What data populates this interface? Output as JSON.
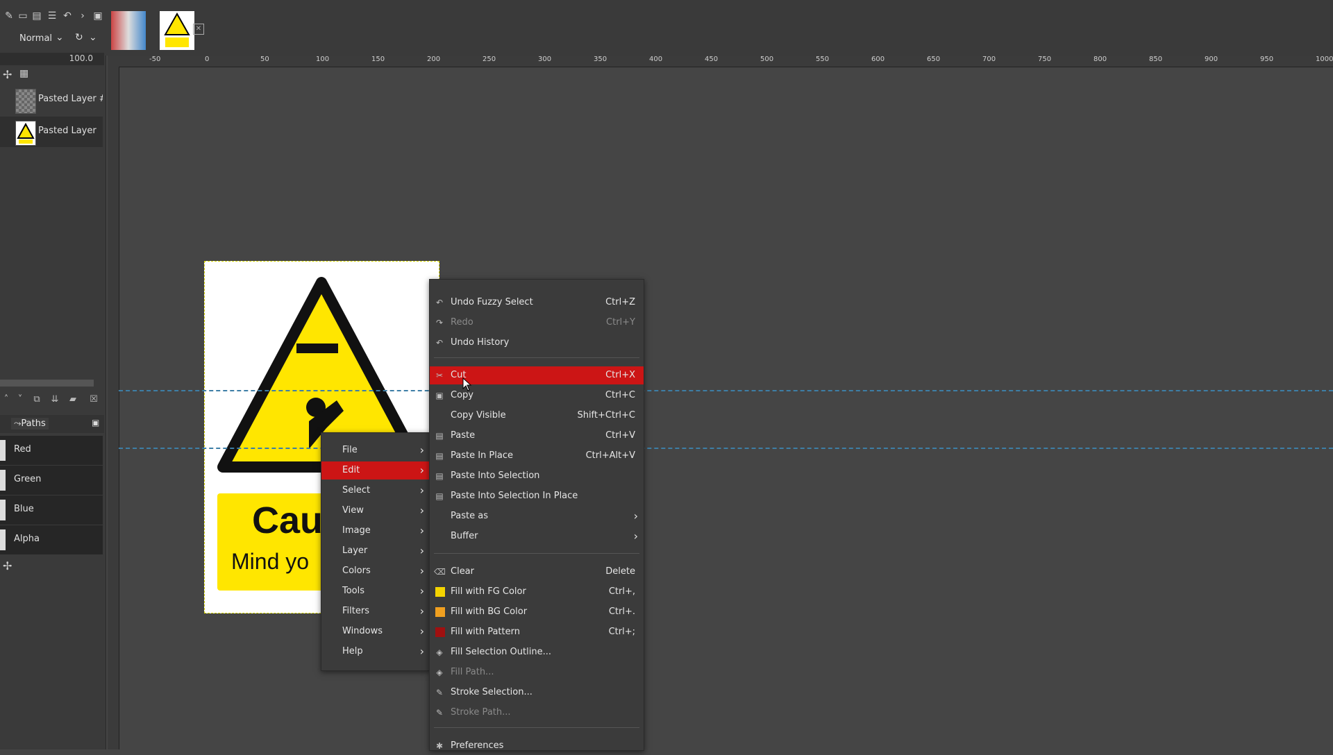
{
  "toolbox": {
    "mode_label": "Normal",
    "opacity_value": "100.0"
  },
  "layers": [
    {
      "name": "Pasted Layer #"
    },
    {
      "name": "Pasted Layer"
    }
  ],
  "dock_tabs": {
    "paths_label": "Paths"
  },
  "channels": [
    {
      "name": "Red"
    },
    {
      "name": "Green"
    },
    {
      "name": "Blue"
    },
    {
      "name": "Alpha"
    }
  ],
  "ruler": {
    "h_labels": [
      "-50",
      "0",
      "50",
      "100",
      "150",
      "200",
      "250",
      "300",
      "350",
      "400",
      "450",
      "500",
      "550",
      "600",
      "650",
      "700",
      "750",
      "800",
      "850",
      "900",
      "950",
      "1000"
    ]
  },
  "canvas": {
    "sign_line1": "Cau",
    "sign_line2": "Mind yo"
  },
  "main_menu": {
    "items": [
      {
        "label": "File"
      },
      {
        "label": "Edit"
      },
      {
        "label": "Select"
      },
      {
        "label": "View"
      },
      {
        "label": "Image"
      },
      {
        "label": "Layer"
      },
      {
        "label": "Colors"
      },
      {
        "label": "Tools"
      },
      {
        "label": "Filters"
      },
      {
        "label": "Windows"
      },
      {
        "label": "Help"
      }
    ]
  },
  "edit_menu": {
    "items": [
      {
        "label": "Undo Fuzzy Select",
        "shortcut": "Ctrl+Z",
        "icon": "undo-icon"
      },
      {
        "label": "Redo",
        "shortcut": "Ctrl+Y",
        "icon": "redo-icon",
        "disabled": true
      },
      {
        "label": "Undo History",
        "shortcut": "",
        "icon": "undo-history-icon"
      },
      {
        "label": "Cut",
        "shortcut": "Ctrl+X",
        "icon": "scissors-icon"
      },
      {
        "label": "Copy",
        "shortcut": "Ctrl+C",
        "icon": "copy-icon"
      },
      {
        "label": "Copy Visible",
        "shortcut": "Shift+Ctrl+C",
        "icon": ""
      },
      {
        "label": "Paste",
        "shortcut": "Ctrl+V",
        "icon": "paste-icon"
      },
      {
        "label": "Paste In Place",
        "shortcut": "Ctrl+Alt+V",
        "icon": "paste-icon"
      },
      {
        "label": "Paste Into Selection",
        "shortcut": "",
        "icon": "paste-icon"
      },
      {
        "label": "Paste Into Selection In Place",
        "shortcut": "",
        "icon": "paste-icon"
      },
      {
        "label": "Paste as",
        "shortcut": "",
        "icon": ""
      },
      {
        "label": "Buffer",
        "shortcut": "",
        "icon": ""
      },
      {
        "label": "Clear",
        "shortcut": "Delete",
        "icon": "clear-icon"
      },
      {
        "label": "Fill with FG Color",
        "shortcut": "Ctrl+,",
        "icon": "fg-color-swatch"
      },
      {
        "label": "Fill with BG Color",
        "shortcut": "Ctrl+.",
        "icon": "bg-color-swatch"
      },
      {
        "label": "Fill with Pattern",
        "shortcut": "Ctrl+;",
        "icon": "pattern-swatch"
      },
      {
        "label": "Fill Selection Outline...",
        "shortcut": "",
        "icon": "fill-icon"
      },
      {
        "label": "Fill Path...",
        "shortcut": "",
        "icon": "fill-icon",
        "disabled": true
      },
      {
        "label": "Stroke Selection...",
        "shortcut": "",
        "icon": "stroke-icon"
      },
      {
        "label": "Stroke Path...",
        "shortcut": "",
        "icon": "stroke-icon",
        "disabled": true
      },
      {
        "label": "Preferences",
        "shortcut": "",
        "icon": "preferences-icon"
      }
    ]
  },
  "colors": {
    "highlight": "#cc1515",
    "fg_color": "#f5d400",
    "bg_color": "#f0a020",
    "pattern": "#a01010"
  }
}
